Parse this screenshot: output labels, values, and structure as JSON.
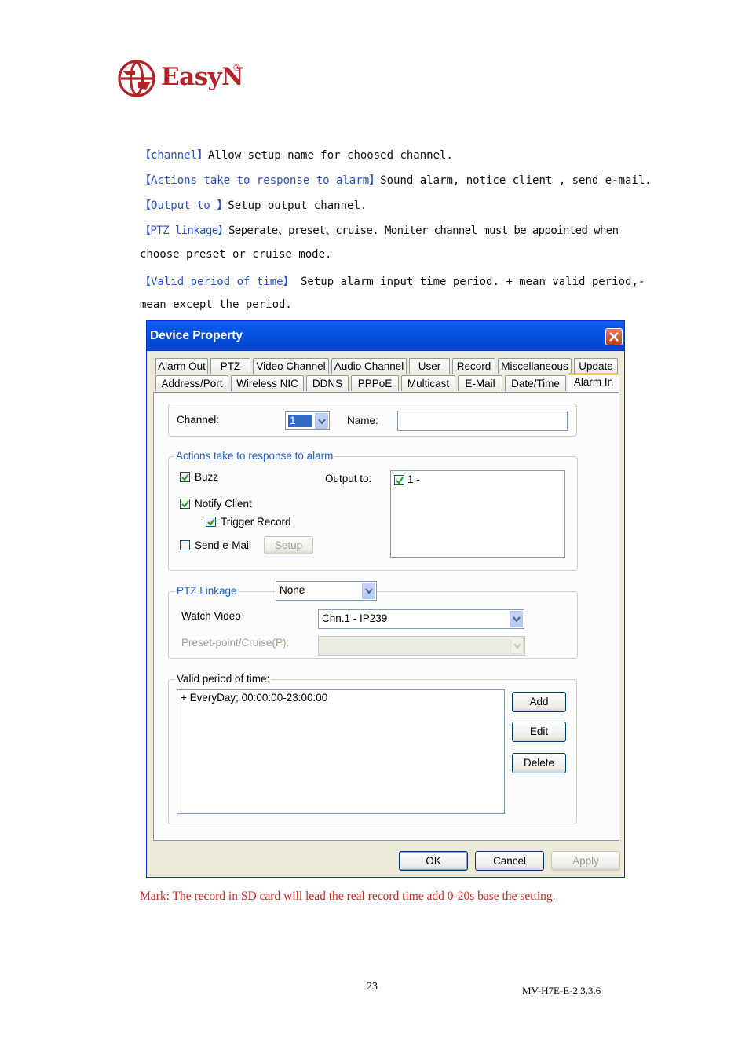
{
  "logo": {
    "text": "EasyN",
    "reg": "®"
  },
  "paragraphs": [
    {
      "term": "channel",
      "text": "Allow setup name for  choosed channel."
    },
    {
      "term": "Actions take to response to alarm",
      "text": "Sound alarm, notice client , send e-mail."
    },
    {
      "term": "Output to ",
      "text": "Setup output channel."
    },
    {
      "term": "PTZ linkage",
      "text": "Seperate、preset、cruise. Moniter channel must be appointed when"
    },
    {
      "text_cont": "choose preset or cruise mode."
    },
    {
      "term": "Valid period of time",
      "text": " Setup alarm input time period. + mean valid period,-"
    },
    {
      "text_cont": "mean except the period."
    }
  ],
  "dialog": {
    "title": "Device Property",
    "tabs_row1": [
      "Alarm Out",
      "PTZ",
      "Video Channel",
      "Audio Channel",
      "User",
      "Record",
      "Miscellaneous",
      "Update"
    ],
    "tabs_row2": [
      "Address/Port",
      "Wireless NIC",
      "DDNS",
      "PPPoE",
      "Multicast",
      "E-Mail",
      "Date/Time",
      "Alarm In"
    ],
    "active_tab": "Alarm In",
    "channel_label": "Channel:",
    "channel_value": "1",
    "name_label": "Name:",
    "name_value": "",
    "actions_legend": "Actions take to response to alarm",
    "buzz": {
      "label": "Buzz",
      "checked": true
    },
    "notify_client": {
      "label": "Notify Client",
      "checked": true
    },
    "trigger_record": {
      "label": "Trigger Record",
      "checked": true
    },
    "send_email": {
      "label": "Send e-Mail",
      "checked": false
    },
    "setup_button": "Setup",
    "output_label": "Output to:",
    "output_item": {
      "label": "1 -",
      "checked": true
    },
    "ptz_legend": "PTZ Linkage",
    "ptz_value": "None",
    "watch_video_label": "Watch Video",
    "watch_video_value": "Chn.1 - IP239",
    "preset_label": "Preset-point/Cruise(P):",
    "valid_legend": "Valid period of time:",
    "valid_items": [
      "+ EveryDay; 00:00:00-23:00:00"
    ],
    "add_button": "Add",
    "edit_button": "Edit",
    "delete_button": "Delete",
    "ok_button": "OK",
    "cancel_button": "Cancel",
    "apply_button": "Apply"
  },
  "mark_note": "Mark: The record in SD card will lead the real record time add 0-20s base the setting.",
  "page_number": "23",
  "doc_code": "MV-H7E-E-2.3.3.6",
  "colors": {
    "brand": "#b3242a",
    "term": "#2a4fcf",
    "note": "#e0201c",
    "titlebar": "#0652e0"
  }
}
